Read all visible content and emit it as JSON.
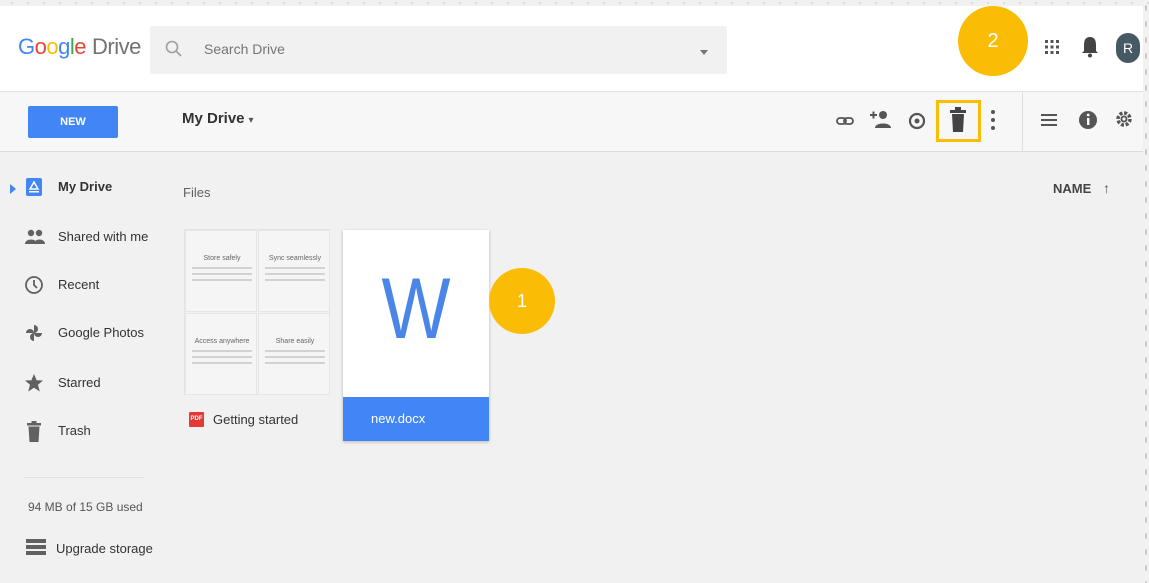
{
  "header": {
    "logo": {
      "g": "G",
      "o1": "o",
      "o2": "o",
      "g2": "g",
      "l": "l",
      "e": "e",
      "product": "Drive"
    },
    "search_placeholder": "Search Drive",
    "icons": [
      "search-icon",
      "caret-down-icon",
      "apps-grid-icon",
      "notifications-icon"
    ],
    "avatar_letter": "R"
  },
  "toolbar": {
    "new_label": "NEW",
    "location_title": "My Drive",
    "location_caret": "▾"
  },
  "sidebar": {
    "items": [
      {
        "label": "My Drive",
        "icon": "my-drive-icon",
        "active": true
      },
      {
        "label": "Shared with me",
        "icon": "shared-icon"
      },
      {
        "label": "Recent",
        "icon": "clock-icon"
      },
      {
        "label": "Google Photos",
        "icon": "photos-pinwheel-icon"
      },
      {
        "label": "Starred",
        "icon": "star-icon"
      },
      {
        "label": "Trash",
        "icon": "trash-icon"
      }
    ],
    "storage_text": "94 MB of 15 GB used",
    "upgrade_label": "Upgrade storage"
  },
  "main": {
    "section_label": "Files",
    "sort_label": "NAME",
    "sort_arrow": "↑",
    "files": [
      {
        "name": "Getting started",
        "type_badge": "PDF",
        "thumb_quadrants": [
          "Store safely",
          "Sync seamlessly",
          "Access anywhere",
          "Share easily"
        ]
      },
      {
        "name": "new.docx",
        "thumb_letter": "W"
      }
    ]
  },
  "annotations": {
    "badge1": "1",
    "badge2": "2"
  },
  "colors": {
    "brand_blue": "#4285f4",
    "highlight_yellow": "#fbbc05",
    "avatar_bg": "#455a64"
  }
}
